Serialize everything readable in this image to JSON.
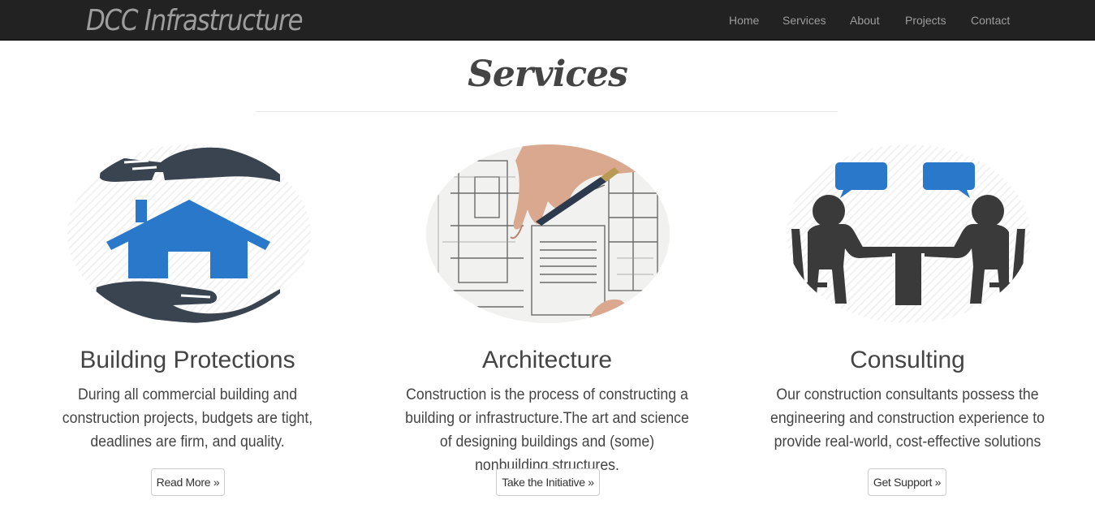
{
  "navbar": {
    "brand": "DCC Infrastructure",
    "links": [
      "Home",
      "Services",
      "About",
      "Projects",
      "Contact"
    ]
  },
  "section": {
    "title": "Services"
  },
  "services": [
    {
      "icon": "house-in-hands-icon",
      "title": "Building Protections",
      "description": "During all commercial building and construction projects, budgets are tight, deadlines are firm, and quality.",
      "button": "Read More »"
    },
    {
      "icon": "blueprint-photo",
      "title": "Architecture",
      "description": "Construction is the process of constructing a building or infrastructure.The art and science of designing buildings and (some) nonbuilding structures.",
      "button": "Take the Initiative »"
    },
    {
      "icon": "consulting-meeting-icon",
      "title": "Consulting",
      "description": "Our construction consultants possess the engineering and construction experience to provide real-world, cost-effective solutions",
      "button": "Get Support »"
    }
  ],
  "colors": {
    "navbar_bg": "#222222",
    "nav_text": "#9d9d9d",
    "icon_dark": "#3a4350",
    "icon_blue": "#2a78c9"
  }
}
